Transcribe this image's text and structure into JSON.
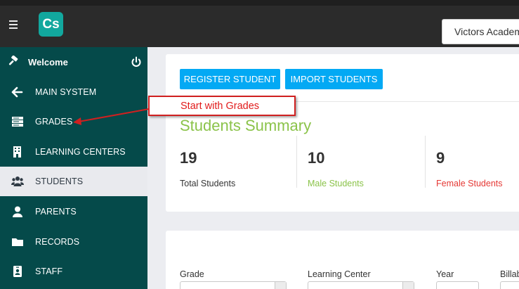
{
  "topbar": {
    "logo_text": "Cs",
    "school_name": "Victors Academy"
  },
  "sidebar": {
    "welcome_label": "Welcome",
    "items": [
      {
        "label": "MAIN SYSTEM",
        "icon": "arrow-left-icon"
      },
      {
        "label": "GRADES",
        "icon": "server-icon"
      },
      {
        "label": "LEARNING CENTERS",
        "icon": "building-icon"
      },
      {
        "label": "STUDENTS",
        "icon": "users-icon",
        "active": true
      },
      {
        "label": "PARENTS",
        "icon": "user-icon"
      },
      {
        "label": "RECORDS",
        "icon": "folder-icon"
      },
      {
        "label": "STAFF",
        "icon": "id-badge-icon"
      }
    ]
  },
  "actions": {
    "register_label": "REGISTER STUDENT",
    "import_label": "IMPORT STUDENTS"
  },
  "summary": {
    "title": "Students Summary",
    "stats": [
      {
        "value": "19",
        "label": "Total Students",
        "color": "#333333"
      },
      {
        "value": "10",
        "label": "Male Students",
        "color": "#8bc34a"
      },
      {
        "value": "9",
        "label": "Female Students",
        "color": "#e53935"
      }
    ]
  },
  "filters": {
    "grade_label": "Grade",
    "learning_center_label": "Learning Center",
    "year_label": "Year",
    "billable_label": "Billab"
  },
  "annotation": {
    "text": "Start with Grades"
  },
  "colors": {
    "sidebar_bg": "#054a4a",
    "button_blue": "#03a9f4",
    "accent_green": "#8bc34a",
    "annotation_red": "#e11b1b"
  }
}
